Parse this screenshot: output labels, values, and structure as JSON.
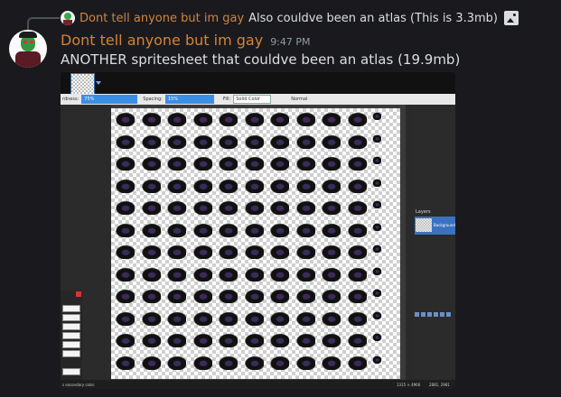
{
  "reply": {
    "author": "Dont tell anyone but im gay",
    "text": "Also couldve been an atlas (This is 3.3mb)",
    "attachment_icon": "image-icon"
  },
  "message": {
    "author": "Dont tell anyone but im gay",
    "timestamp": "9:47 PM",
    "text": "ANOTHER spritesheet that couldve been an atlas (19.9mb)"
  },
  "colors": {
    "background": "#1a1a1e",
    "username": "#d1843a",
    "text": "#dbdee1",
    "timestamp": "#949ba4"
  },
  "attachment": {
    "options_bar": {
      "hardness_label": "rdness:",
      "hardness_value": "75%",
      "spacing_label": "Spacing:",
      "spacing_value": "15%",
      "fill_label": "Fill:",
      "fill_value": "Solid Color",
      "blend_value": "Normal"
    },
    "layers_title": "Layers",
    "layer_name": "Background",
    "status_left": "s secondary color.",
    "status_size": "1315 × 4966",
    "status_coords": "2881, 2981"
  }
}
